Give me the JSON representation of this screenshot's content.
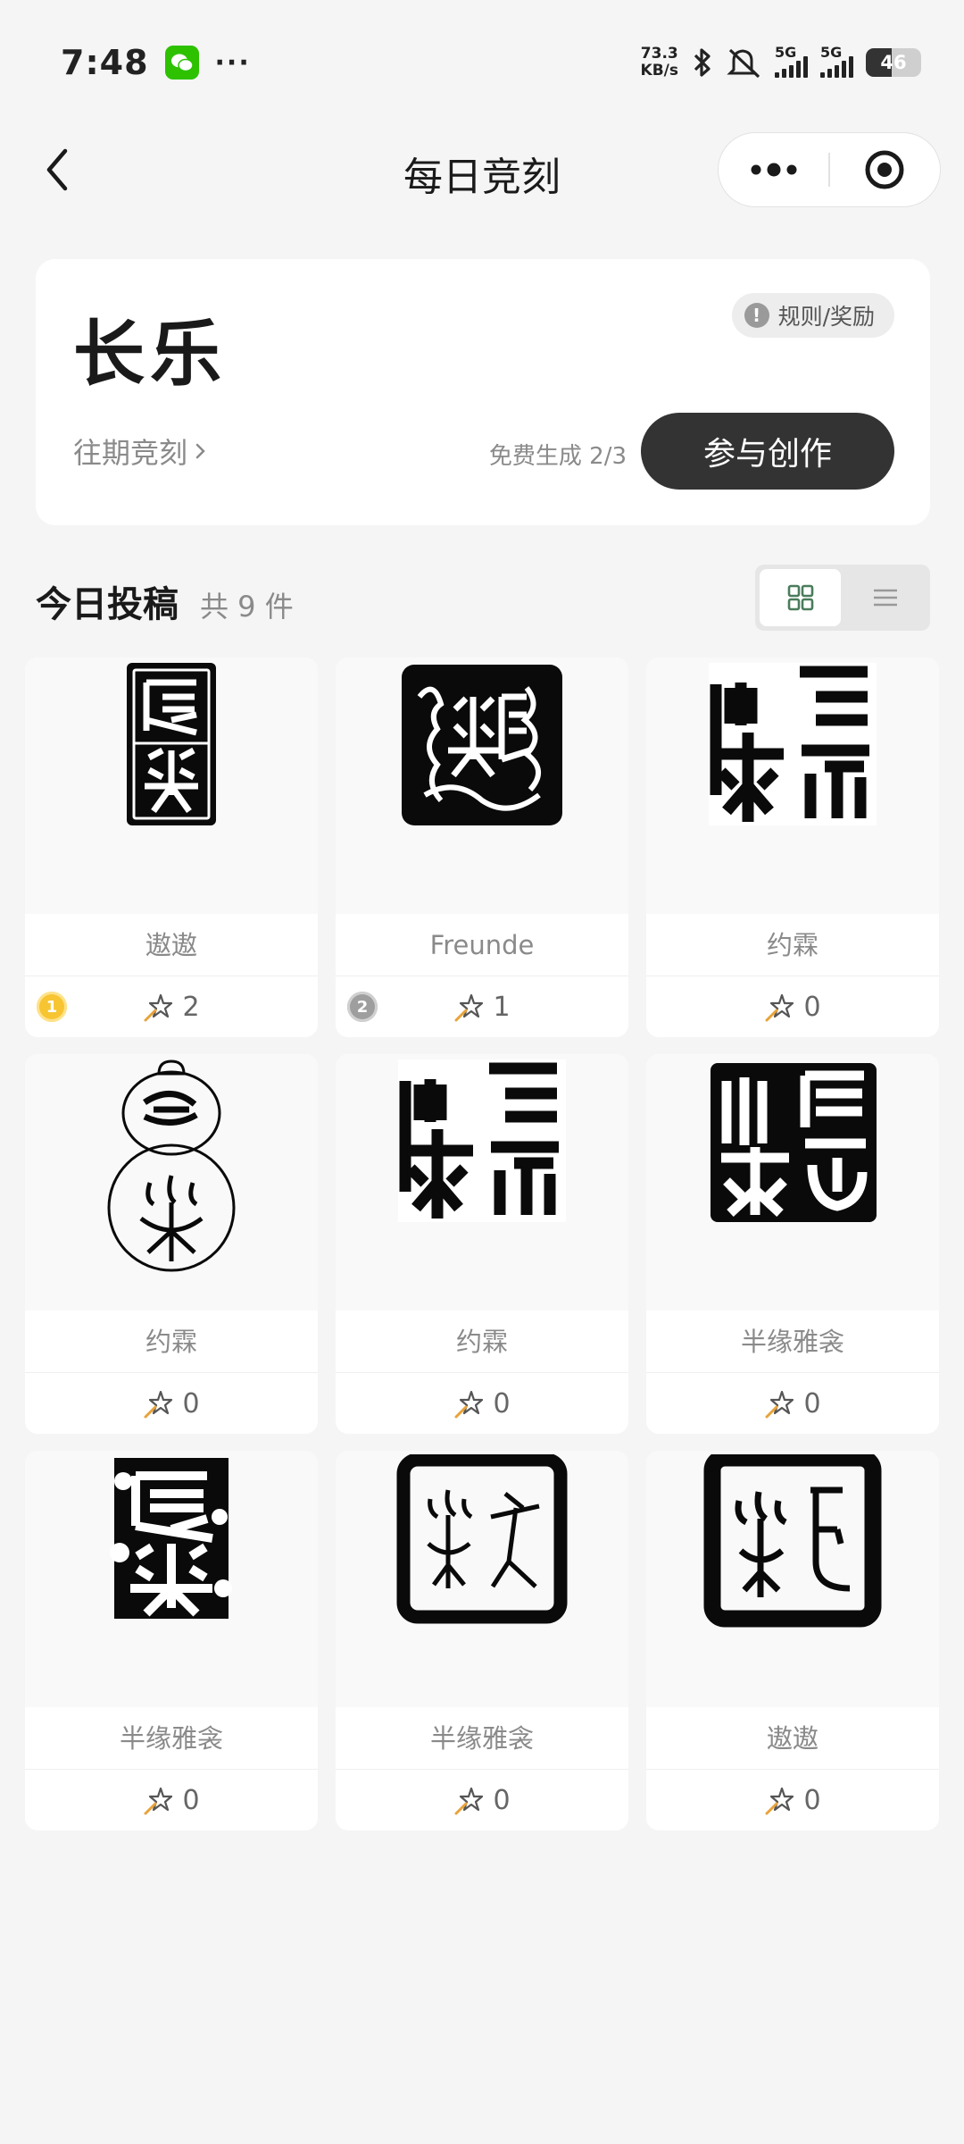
{
  "status_bar": {
    "time": "7:48",
    "dots": "···",
    "net_speed_value": "73.3",
    "net_speed_unit": "KB/s",
    "sim1": "5G",
    "sim2": "5G",
    "battery": "46"
  },
  "nav": {
    "title": "每日竞刻"
  },
  "topic": {
    "title": "长乐",
    "rules_label": "规则/奖励",
    "past_label": "往期竞刻",
    "free_label": "免费生成 2/3",
    "create_label": "参与创作"
  },
  "section": {
    "title": "今日投稿",
    "count": "共 9 件"
  },
  "submissions": [
    {
      "author": "遨遨",
      "likes": "2",
      "rank": "1",
      "style": "tall-white"
    },
    {
      "author": "Freunde",
      "likes": "1",
      "rank": "2",
      "style": "square-bird"
    },
    {
      "author": "约霖",
      "likes": "0",
      "style": "square-white"
    },
    {
      "author": "约霖",
      "likes": "0",
      "style": "gourd"
    },
    {
      "author": "约霖",
      "likes": "0",
      "style": "square-white"
    },
    {
      "author": "半缘雅衾",
      "likes": "0",
      "style": "square-black"
    },
    {
      "author": "半缘雅衾",
      "likes": "0",
      "style": "tall-rough"
    },
    {
      "author": "半缘雅衾",
      "likes": "0",
      "style": "frame-thin"
    },
    {
      "author": "遨遨",
      "likes": "0",
      "style": "frame-thick"
    }
  ]
}
